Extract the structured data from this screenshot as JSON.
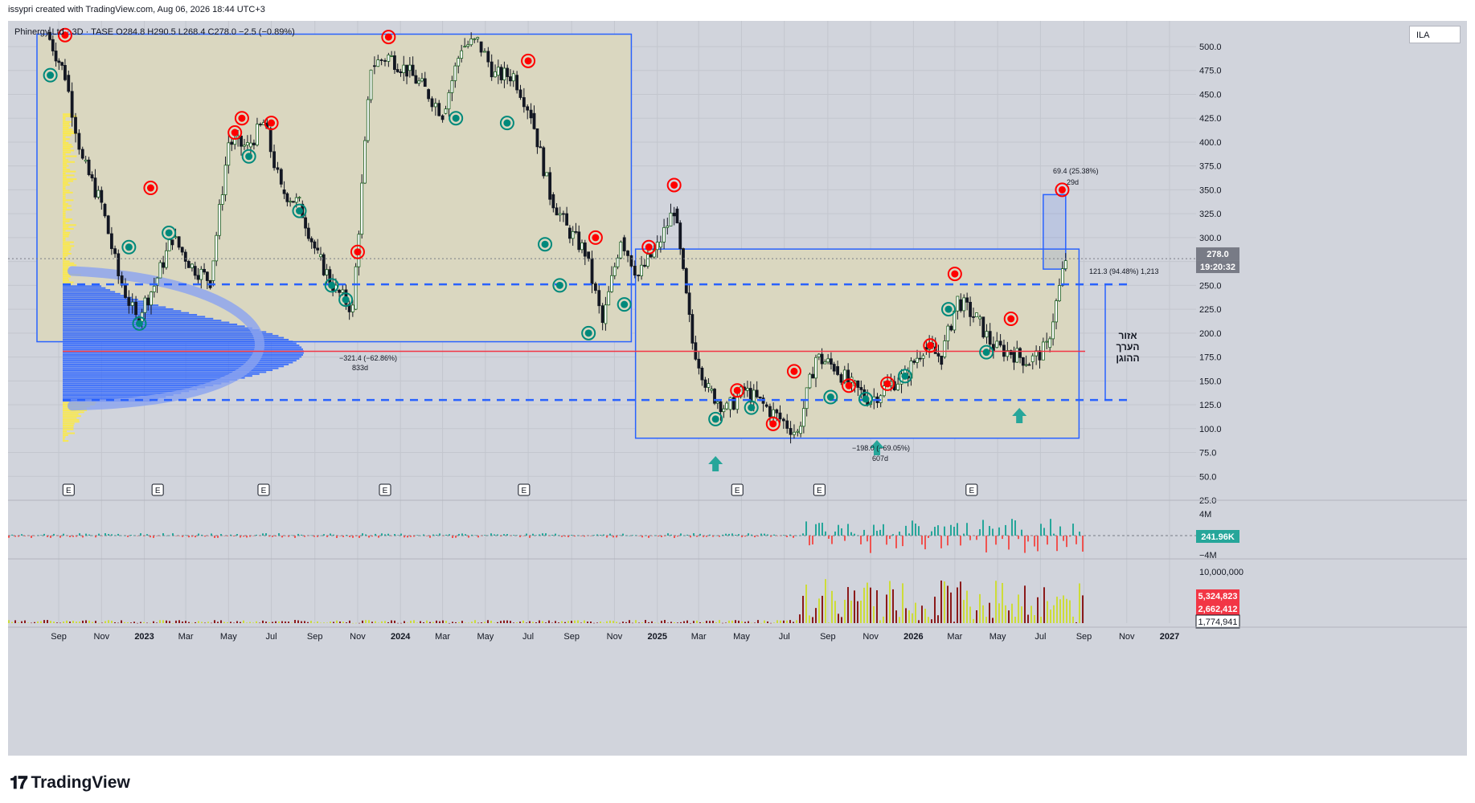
{
  "caption": "issypri created with TradingView.com, Aug 06, 2026 18:44 UTC+3",
  "header": {
    "ticker_line": "Phinergy Ltd · 3D · TASE O284.8 H290.5 L268.4 C278.0 −2.5 (−0.89%)",
    "currency": "ILA"
  },
  "brand": {
    "name": "TradingView",
    "icon": "tv-logo-icon"
  },
  "colors": {
    "background": "#d1d4dc",
    "box_fill": "#dad7c0",
    "box_stroke": "#2962ff",
    "up": "#26a69a",
    "down": "#ef5350",
    "profile_blue": "#2962ff",
    "profile_yellow": "#ffeb3b",
    "poc_line": "#f23645"
  },
  "price_badges": {
    "last": "278.0",
    "countdown": "19:20:32",
    "delta": "241.96K",
    "vol1": "5,324,823",
    "vol2": "2,662,412",
    "vol3": "1,774,941"
  },
  "annotations": {
    "zone_label": "אזור\nהערך\nההוגן",
    "measure1": "−321.4 (−62.86%)",
    "measure1_days": "833d",
    "measure2": "−198.0 (−69.05%)",
    "measure2_days": "607d",
    "measure3": "69.4 (25.38%)",
    "measure3_days": "29d",
    "measure4": "121.3 (94.48%) 1,213"
  },
  "earnings_marker": "E",
  "delta_axis": [
    "4M",
    "−4M"
  ],
  "volume_axis": [
    "10,000,000"
  ],
  "chart_data": {
    "type": "line",
    "title": "Phinergy Ltd · 3D · TASE",
    "xlabel": "",
    "ylabel": "",
    "ylim": [
      25,
      525
    ],
    "y_ticks": [
      "500.0",
      "475.0",
      "450.0",
      "425.0",
      "400.0",
      "375.0",
      "350.0",
      "325.0",
      "300.0",
      "275.0",
      "250.0",
      "225.0",
      "200.0",
      "175.0",
      "150.0",
      "125.0",
      "100.0",
      "75.0",
      "50.0",
      "25.0"
    ],
    "x_ticks": [
      "Sep",
      "Nov",
      "2023",
      "Mar",
      "May",
      "Jul",
      "Sep",
      "Nov",
      "2024",
      "Mar",
      "May",
      "Jul",
      "Sep",
      "Nov",
      "2025",
      "Mar",
      "May",
      "Jul",
      "Sep",
      "Nov",
      "2026",
      "Mar",
      "May",
      "Jul",
      "Sep",
      "Nov",
      "2027"
    ],
    "x": [
      "2022-08-15",
      "2022-09-10",
      "2022-10-05",
      "2022-11-01",
      "2022-11-25",
      "2022-12-20",
      "2023-01-15",
      "2023-02-10",
      "2023-03-10",
      "2023-04-05",
      "2023-05-01",
      "2023-05-28",
      "2023-06-20",
      "2023-07-15",
      "2023-08-10",
      "2023-09-05",
      "2023-10-01",
      "2023-10-25",
      "2023-11-20",
      "2023-12-15",
      "2024-01-10",
      "2024-02-05",
      "2024-03-01",
      "2024-03-28",
      "2024-04-20",
      "2024-05-15",
      "2024-06-10",
      "2024-07-05",
      "2024-08-01",
      "2024-08-25",
      "2024-09-20",
      "2024-10-15",
      "2024-11-10",
      "2024-12-05",
      "2025-01-01",
      "2025-01-25",
      "2025-02-20",
      "2025-03-15",
      "2025-04-10",
      "2025-05-05",
      "2025-06-01",
      "2025-06-25",
      "2025-07-20",
      "2025-08-15",
      "2025-09-10",
      "2025-10-05",
      "2025-11-01",
      "2025-11-25",
      "2025-12-20",
      "2026-01-15",
      "2026-02-10",
      "2026-03-05",
      "2026-04-01",
      "2026-04-25",
      "2026-05-20",
      "2026-06-15",
      "2026-07-10",
      "2026-08-06"
    ],
    "series": [
      {
        "values": [
          515,
          470,
          380,
          335,
          260,
          215,
          250,
          300,
          270,
          255,
          400,
          395,
          420,
          350,
          335,
          280,
          245,
          225,
          480,
          490,
          475,
          455,
          430,
          500,
          505,
          470,
          470,
          430,
          345,
          310,
          285,
          210,
          300,
          260,
          290,
          330,
          190,
          140,
          120,
          140,
          125,
          110,
          95,
          175,
          165,
          145,
          130,
          145,
          155,
          185,
          175,
          235,
          215,
          185,
          180,
          170,
          185,
          278
        ]
      }
    ],
    "volume_profile": {
      "poc": 181,
      "value_area_high": 251,
      "value_area_low": 130
    },
    "boxes": [
      {
        "from": "2022-08-01",
        "to": "2024-11-25",
        "low": 191,
        "high": 513
      },
      {
        "from": "2024-12-01",
        "to": "2026-08-25",
        "low": 90,
        "high": 288
      },
      {
        "from": "2026-07-05",
        "to": "2026-08-06",
        "low": 267,
        "high": 345
      }
    ]
  }
}
